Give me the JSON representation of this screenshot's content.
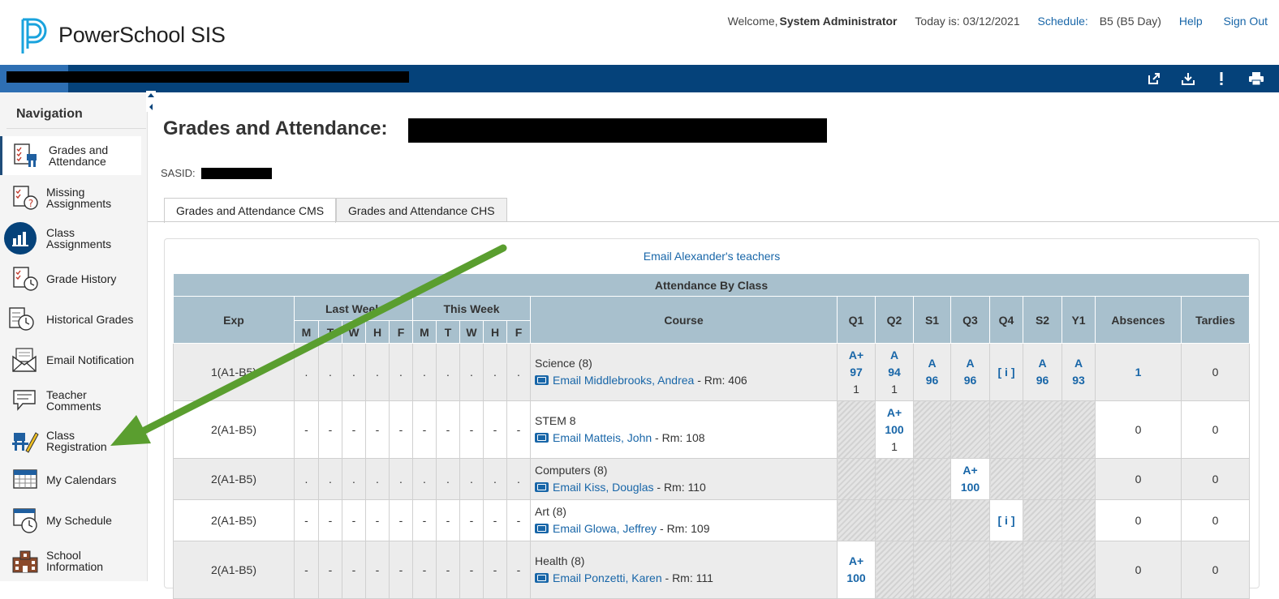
{
  "header": {
    "brand": "PowerSchool SIS",
    "welcome": "Welcome,",
    "user": "System Administrator",
    "today": "Today is: 03/12/2021",
    "schedule_label": "Schedule:",
    "schedule_value": "B5 (B5 Day)",
    "help": "Help",
    "signout": "Sign Out"
  },
  "toolbar_icons": [
    "external-link-icon",
    "download-icon",
    "alert-icon",
    "print-icon"
  ],
  "sidebar": {
    "title": "Navigation",
    "items": [
      {
        "label": "Grades and Attendance",
        "icon": "grades-attendance-icon"
      },
      {
        "label": "Missing Assignments",
        "icon": "missing-assignments-icon"
      },
      {
        "label": "Class Assignments",
        "icon": "class-assignments-icon"
      },
      {
        "label": "Grade History",
        "icon": "grade-history-icon"
      },
      {
        "label": "Historical Grades",
        "icon": "historical-grades-icon"
      },
      {
        "label": "Email Notification",
        "icon": "email-notification-icon"
      },
      {
        "label": "Teacher Comments",
        "icon": "teacher-comments-icon"
      },
      {
        "label": "Class Registration",
        "icon": "class-registration-icon"
      },
      {
        "label": "My Calendars",
        "icon": "calendar-icon"
      },
      {
        "label": "My Schedule",
        "icon": "schedule-icon"
      },
      {
        "label": "School Information",
        "icon": "school-icon"
      }
    ]
  },
  "main": {
    "title": "Grades and Attendance: ",
    "sasid_label": "SASID:",
    "tabs": [
      "Grades and Attendance CMS",
      "Grades and Attendance CHS"
    ],
    "email_all": "Email Alexander's teachers"
  },
  "table": {
    "caption": "Attendance By Class",
    "headers": {
      "exp": "Exp",
      "last_week": "Last Week",
      "this_week": "This Week",
      "days": [
        "M",
        "T",
        "W",
        "H",
        "F"
      ],
      "course": "Course",
      "terms": [
        "Q1",
        "Q2",
        "S1",
        "Q3",
        "Q4",
        "S2",
        "Y1"
      ],
      "absences": "Absences",
      "tardies": "Tardies"
    },
    "rows": [
      {
        "exp": "1(A1-B5)",
        "att": [
          ".",
          ".",
          ".",
          ".",
          ".",
          ".",
          ".",
          ".",
          ".",
          "."
        ],
        "course": "Science (8)",
        "teacher": "Email Middlebrooks, Andrea",
        "room": " - Rm: 406",
        "grades": [
          {
            "g": "A+",
            "s": "97",
            "n": "1"
          },
          {
            "g": "A",
            "s": "94",
            "n": "1"
          },
          {
            "g": "A",
            "s": "96",
            "n": ""
          },
          {
            "g": "A",
            "s": "96",
            "n": ""
          },
          {
            "g": "[ i ]",
            "s": "",
            "n": ""
          },
          {
            "g": "A",
            "s": "96",
            "n": ""
          },
          {
            "g": "A",
            "s": "93",
            "n": ""
          }
        ],
        "absences": "1",
        "tardies": "0"
      },
      {
        "exp": "2(A1-B5)",
        "att": [
          "-",
          "-",
          "-",
          "-",
          "-",
          "-",
          "-",
          "-",
          "-",
          "-"
        ],
        "course": "STEM 8",
        "teacher": "Email Matteis, John",
        "room": " - Rm: 108",
        "grades": [
          null,
          {
            "g": "A+",
            "s": "100",
            "n": "1"
          },
          null,
          null,
          null,
          null,
          null
        ],
        "absences": "0",
        "tardies": "0"
      },
      {
        "exp": "2(A1-B5)",
        "att": [
          ".",
          ".",
          ".",
          ".",
          ".",
          ".",
          ".",
          ".",
          ".",
          "."
        ],
        "course": "Computers (8)",
        "teacher": "Email Kiss, Douglas",
        "room": " - Rm: 110",
        "grades": [
          null,
          null,
          null,
          {
            "g": "A+",
            "s": "100",
            "n": ""
          },
          null,
          null,
          null
        ],
        "absences": "0",
        "tardies": "0"
      },
      {
        "exp": "2(A1-B5)",
        "att": [
          "-",
          "-",
          "-",
          "-",
          "-",
          "-",
          "-",
          "-",
          "-",
          "-"
        ],
        "course": "Art (8)",
        "teacher": "Email Glowa, Jeffrey",
        "room": " - Rm: 109",
        "grades": [
          null,
          null,
          null,
          null,
          {
            "g": "[ i ]",
            "s": "",
            "n": ""
          },
          null,
          null
        ],
        "absences": "0",
        "tardies": "0"
      },
      {
        "exp": "2(A1-B5)",
        "att": [
          "-",
          "-",
          "-",
          "-",
          "-",
          "-",
          "-",
          "-",
          "-",
          "-"
        ],
        "course": "Health (8)",
        "teacher": "Email Ponzetti, Karen",
        "room": " - Rm: 111",
        "grades": [
          {
            "g": "A+",
            "s": "100",
            "n": ""
          },
          null,
          null,
          null,
          null,
          null,
          null
        ],
        "absences": "0",
        "tardies": "0"
      }
    ]
  },
  "colors": {
    "blue_bar": "#05427a",
    "table_header": "#a8c0cd",
    "link": "#1866a8",
    "arrow": "#5a9e2f"
  }
}
